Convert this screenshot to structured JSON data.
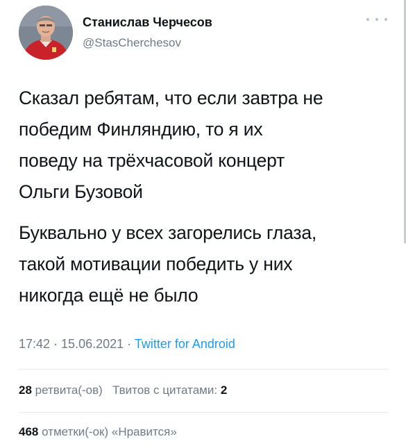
{
  "author": {
    "name": "Станислав Черчесов",
    "handle": "@StasCherchesov"
  },
  "more_icon": "more-dots-icon",
  "tweet": {
    "paragraph1": [
      "Сказал ребятам, что если завтра не",
      "победим Финляндию, то я их",
      "поведу на трёхчасовой концерт",
      "Ольги Бузовой"
    ],
    "paragraph2": [
      "Буквально у всех загорелись глаза,",
      "такой мотивации победить у них",
      "никогда ещё не было"
    ]
  },
  "meta": {
    "time": "17:42",
    "separator": " · ",
    "date": "15.06.2021",
    "source": "Twitter for Android"
  },
  "stats": {
    "retweets_count": "28",
    "retweets_label": "ретвита(-ов)",
    "quotes_label": "Твитов с цитатами:",
    "quotes_count": "2",
    "likes_count": "468",
    "likes_label": "отметки(-ок) «Нравится»"
  },
  "colors": {
    "text": "#0f1419",
    "secondary": "#6e7b87",
    "link": "#1d9bf0",
    "divider": "#e6ecf0"
  }
}
